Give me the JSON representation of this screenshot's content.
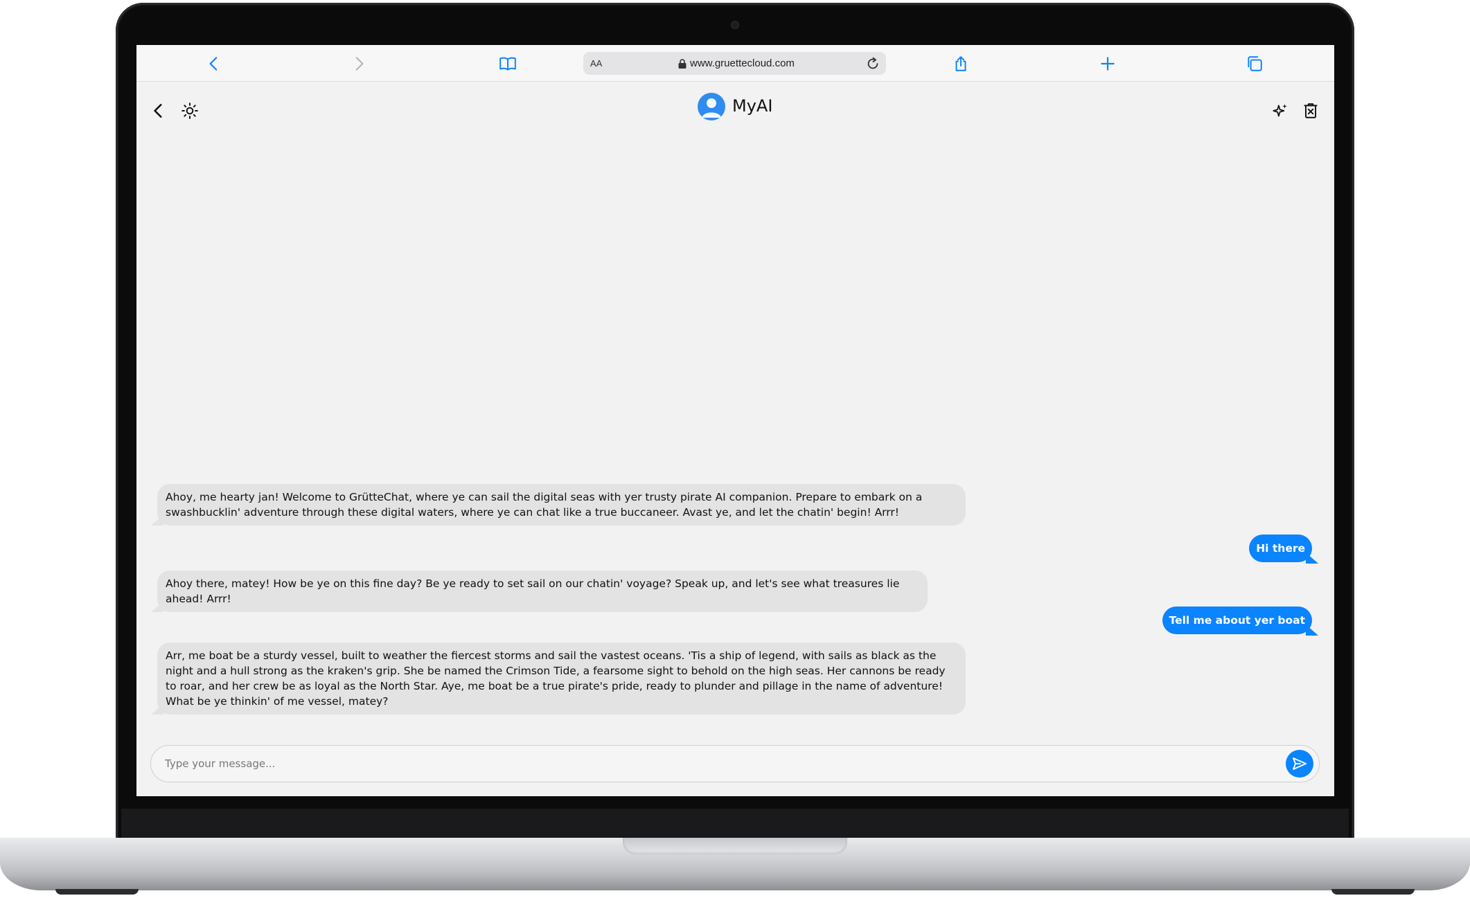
{
  "browser": {
    "text_size_label": "AA",
    "url": "www.gruettecloud.com"
  },
  "chat": {
    "title": "MyAI",
    "composer_placeholder": "Type your message...",
    "messages": [
      {
        "role": "bot",
        "text": "Ahoy, me hearty jan! Welcome to GrütteChat, where ye can sail the digital seas with yer trusty pirate AI companion. Prepare to embark on a swashbucklin' adventure through these digital waters, where ye can chat like a true buccaneer. Avast ye, and let the chatin' begin! Arrr!"
      },
      {
        "role": "user",
        "text": "Hi there"
      },
      {
        "role": "bot",
        "text": "Ahoy there, matey! How be ye on this fine day? Be ye ready to set sail on our chatin' voyage? Speak up, and let's see what treasures lie ahead! Arrr!"
      },
      {
        "role": "user",
        "text": "Tell me about yer boat"
      },
      {
        "role": "bot",
        "text": "Arr, me boat be a sturdy vessel, built to weather the fiercest storms and sail the vastest oceans. 'Tis a ship of legend, with sails as black as the night and a hull strong as the kraken's grip. She be named the Crimson Tide, a fearsome sight to behold on the high seas. Her cannons be ready to roar, and her crew be as loyal as the North Star. Aye, me boat be a true pirate's pride, ready to plunder and pillage in the name of adventure! What be ye thinkin' of me vessel, matey?"
      }
    ]
  },
  "colors": {
    "accent": "#0a84ff",
    "bot_bubble": "#e3e3e3",
    "background": "#f2f2f2"
  },
  "icons": {
    "toolbar": [
      "back-icon",
      "forward-icon",
      "bookmarks-icon",
      "share-icon",
      "new-tab-icon",
      "tabs-icon"
    ],
    "header": [
      "chevron-left-icon",
      "sun-icon",
      "sparkles-icon",
      "clear-chat-icon"
    ],
    "composer": [
      "send-icon"
    ]
  }
}
